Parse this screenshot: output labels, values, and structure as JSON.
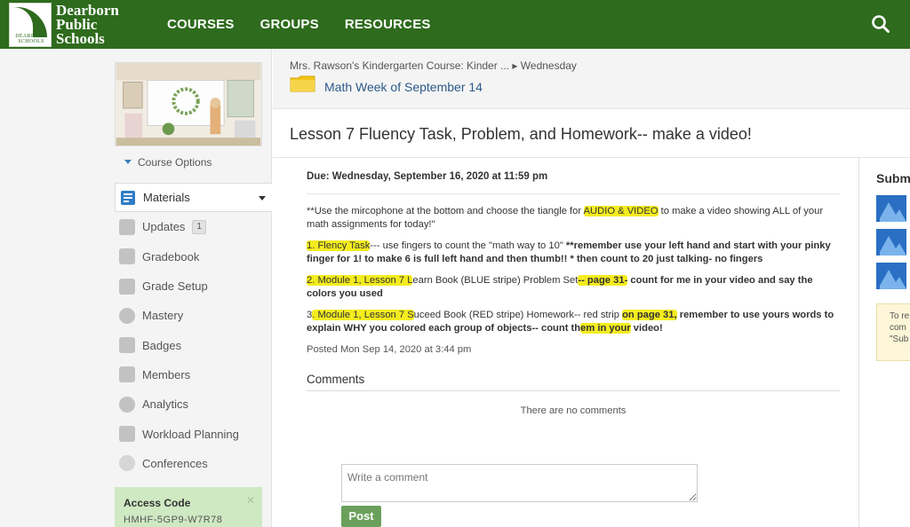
{
  "brand": {
    "line1": "Dearborn",
    "line2": "Public",
    "line3": "Schools",
    "mark_text": "DEARBORN SCHOOLS"
  },
  "nav": {
    "courses": "COURSES",
    "groups": "GROUPS",
    "resources": "RESOURCES"
  },
  "sidebar": {
    "course_options": "Course Options",
    "items": [
      {
        "label": "Materials",
        "icon": "materials-icon",
        "active": true
      },
      {
        "label": "Updates",
        "icon": "updates-icon",
        "badge": "1"
      },
      {
        "label": "Gradebook",
        "icon": "gradebook-icon"
      },
      {
        "label": "Grade Setup",
        "icon": "grade-setup-icon"
      },
      {
        "label": "Mastery",
        "icon": "mastery-icon"
      },
      {
        "label": "Badges",
        "icon": "badges-icon"
      },
      {
        "label": "Members",
        "icon": "members-icon"
      },
      {
        "label": "Analytics",
        "icon": "analytics-icon"
      },
      {
        "label": "Workload Planning",
        "icon": "workload-icon"
      },
      {
        "label": "Conferences",
        "icon": "conferences-icon"
      }
    ],
    "access_code_label": "Access Code",
    "access_code": "HMHF-5GP9-W7R78"
  },
  "breadcrumb": {
    "course": "Mrs. Rawson's Kindergarten Course: Kinder ...",
    "separator": "▸",
    "current": "Wednesday",
    "folder_title": "Math Week of September 14"
  },
  "assignment": {
    "title": "Lesson 7 Fluency Task, Problem, and Homework-- make a video!",
    "due": "Due: Wednesday, September 16, 2020 at 11:59 pm",
    "p0_a": "**Use the mircophone at the bottom and choose the tiangle  for ",
    "p0_hl": "AUDIO & VIDEO",
    "p0_b": " to make a video showing ALL of your math assignments for today!\"",
    "p1_hl": "1.  Flency Task",
    "p1_a": "--- use fingers to count the \"math way to 10\"  ",
    "p1_b": "**remember use your left hand and start with your pinky finger for 1! to make 6 is full left hand and then thumb!!    * then count to 20 just talking- no fingers",
    "p2_hl": "2.  Module 1, Lesson 7 L",
    "p2_a": "earn Book (BLUE stripe) Problem Set",
    "p2_hl2": "-- page 31-",
    "p2_b": " count for me in your video and say the colors you used",
    "p3_a": "3",
    "p3_hl": ". Module 1, Lesson 7 S",
    "p3_b": "uceed Book (RED stripe) Homework-- red strip ",
    "p3_hl2": "on page 31,",
    "p3_c": " remember to use yours words to explain WHY you colored each group of objects-- count th",
    "p3_hl3": "em in your",
    "p3_d": " video!",
    "posted": "Posted Mon Sep 14, 2020 at 3:44 pm"
  },
  "comments": {
    "heading": "Comments",
    "empty": "There are no comments",
    "placeholder": "Write a comment",
    "post_label": "Post"
  },
  "right_panel": {
    "heading": "Subm",
    "note_lines": [
      "To re",
      "com",
      "\"Sub"
    ]
  },
  "colors": {
    "header_green": "#2e6b1d",
    "highlight": "#f4ec1f",
    "link_blue": "#2c5a8a",
    "post_green": "#6ba05c"
  }
}
